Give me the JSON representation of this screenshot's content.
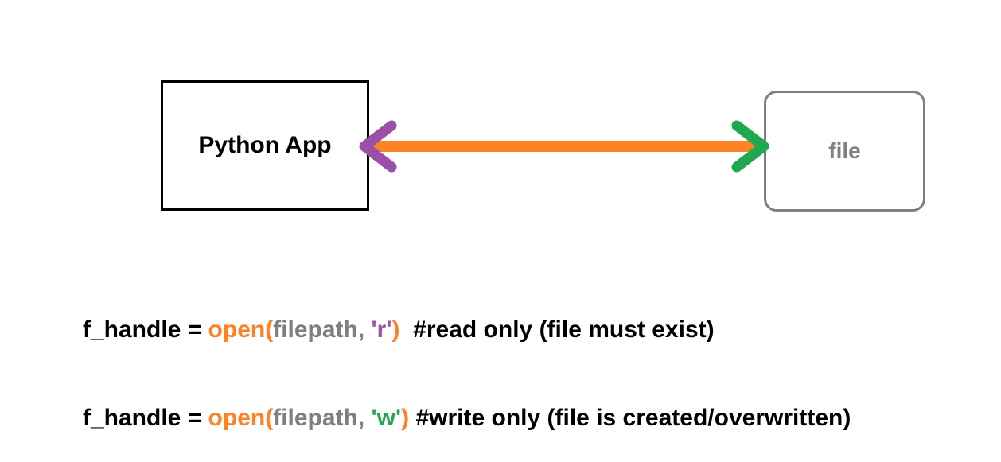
{
  "app_box": {
    "label": "Python App"
  },
  "file_box": {
    "label": "file"
  },
  "arrow": {
    "shaft_color": "#fd8125",
    "left_head_color": "#9b4fa8",
    "right_head_color": "#1fa84f",
    "direction": "bidirectional"
  },
  "code": {
    "lines": [
      {
        "prefix": "f_handle = ",
        "func": "open(",
        "arg": "filepath, ",
        "mode": "'r'",
        "close": ")",
        "comment": "  #read only (file must exist)"
      },
      {
        "prefix": "f_handle = ",
        "func": "open(",
        "arg": "filepath, ",
        "mode": "'w'",
        "close": ")",
        "comment": " #write only (file is created/overwritten)"
      }
    ]
  },
  "colors": {
    "func": "#fd8125",
    "arg": "#7f7f7f",
    "read_mode": "#9b4fa8",
    "write_mode": "#1fa84f"
  }
}
